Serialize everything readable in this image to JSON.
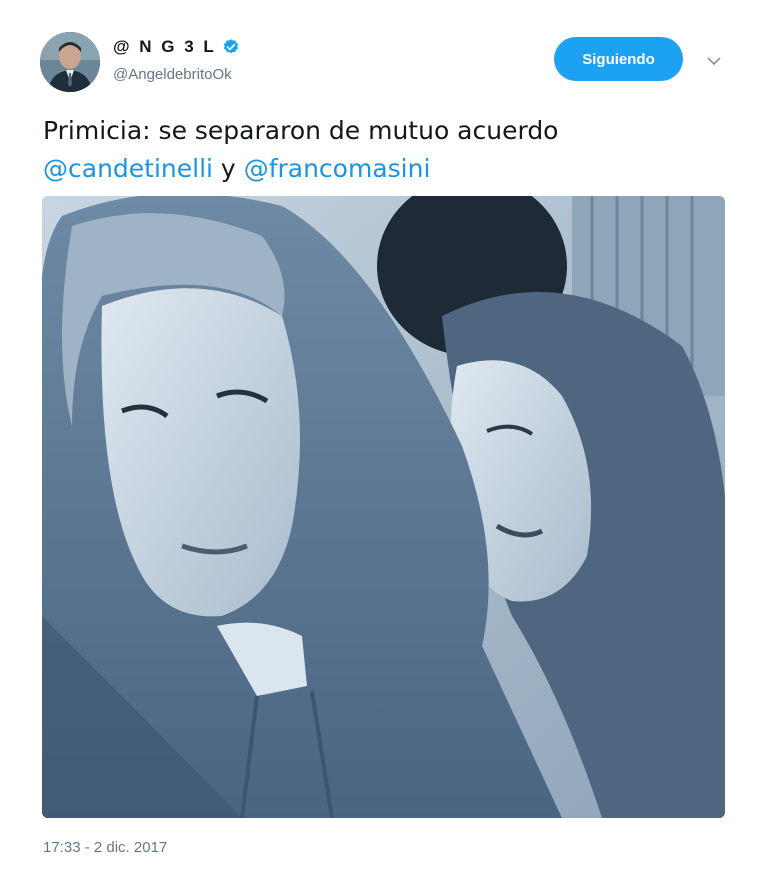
{
  "tweet": {
    "display_name": "@ N G 3 L",
    "handle": "@AngeldebritoOk",
    "verified": true,
    "follow_button_label": "Siguiendo",
    "text_intro": "Primicia: se separaron de mutuo acuerdo",
    "mention_1": "@candetinelli",
    "conjunction": " y ",
    "mention_2": "@francomasini",
    "timestamp": "17:33 - 2 dic. 2017"
  },
  "icons": {
    "verified": "verified-badge-icon",
    "more": "chevron-down-icon"
  },
  "colors": {
    "accent": "#1da1f2",
    "link": "#1b95e0",
    "secondary_text": "#657786",
    "primary_text": "#14171a"
  }
}
